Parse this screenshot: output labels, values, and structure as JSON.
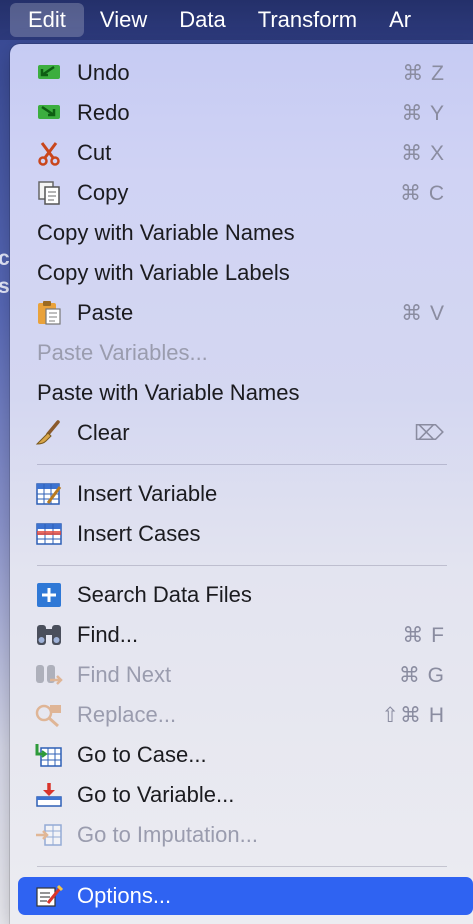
{
  "menubar": {
    "items": [
      "Edit",
      "View",
      "Data",
      "Transform",
      "Ar"
    ]
  },
  "background": {
    "fragments": [
      "c",
      "sh"
    ]
  },
  "menu": {
    "items": [
      {
        "label": "Undo",
        "shortcut": "⌘ Z",
        "icon": "undo-icon"
      },
      {
        "label": "Redo",
        "shortcut": "⌘ Y",
        "icon": "redo-icon"
      },
      {
        "label": "Cut",
        "shortcut": "⌘ X",
        "icon": "scissors-icon"
      },
      {
        "label": "Copy",
        "shortcut": "⌘ C",
        "icon": "copy-icon"
      },
      {
        "label": "Copy with Variable Names",
        "shortcut": ""
      },
      {
        "label": "Copy with Variable Labels",
        "shortcut": ""
      },
      {
        "label": "Paste",
        "shortcut": "⌘ V",
        "icon": "clipboard-icon"
      },
      {
        "label": "Paste Variables...",
        "shortcut": "",
        "disabled": true
      },
      {
        "label": "Paste with Variable Names",
        "shortcut": ""
      },
      {
        "label": "Clear",
        "shortcut": "⌦",
        "icon": "brush-icon"
      },
      {
        "label": "Insert Variable",
        "shortcut": "",
        "icon": "insert-variable-icon"
      },
      {
        "label": "Insert Cases",
        "shortcut": "",
        "icon": "insert-cases-icon"
      },
      {
        "label": "Search Data Files",
        "shortcut": "",
        "icon": "plus-box-icon"
      },
      {
        "label": "Find...",
        "shortcut": "⌘ F",
        "icon": "binoculars-icon"
      },
      {
        "label": "Find Next",
        "shortcut": "⌘ G",
        "icon": "find-next-icon",
        "disabled": true
      },
      {
        "label": "Replace...",
        "shortcut": "⇧⌘ H",
        "icon": "replace-icon",
        "disabled": true
      },
      {
        "label": "Go to Case...",
        "shortcut": "",
        "icon": "goto-case-icon"
      },
      {
        "label": "Go to Variable...",
        "shortcut": "",
        "icon": "goto-variable-icon"
      },
      {
        "label": "Go to Imputation...",
        "shortcut": "",
        "icon": "goto-imputation-icon",
        "disabled": true
      },
      {
        "label": "Options...",
        "shortcut": "",
        "icon": "options-icon",
        "selected": true
      }
    ]
  },
  "colors": {
    "selection": "#2f63f2",
    "menubar": "#2d3a7c"
  }
}
